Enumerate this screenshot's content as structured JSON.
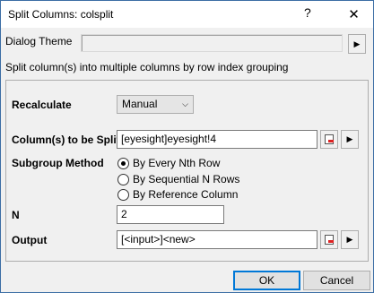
{
  "window": {
    "title": "Split Columns: colsplit",
    "help": "?",
    "close": "✕"
  },
  "theme": {
    "label": "Dialog Theme",
    "arrow": "▶"
  },
  "description": "Split column(s) into multiple columns by row index grouping",
  "recalculate": {
    "label": "Recalculate",
    "value": "Manual",
    "chevron": "⌵"
  },
  "columns": {
    "label": "Column(s) to be Split",
    "value": "[eyesight]eyesight!4",
    "arrow": "▶"
  },
  "subgroup": {
    "label": "Subgroup Method",
    "options": [
      {
        "label": "By Every Nth Row",
        "selected": true
      },
      {
        "label": "By Sequential N Rows",
        "selected": false
      },
      {
        "label": "By Reference Column",
        "selected": false
      }
    ]
  },
  "n": {
    "label": "N",
    "value": "2"
  },
  "output": {
    "label": "Output",
    "value": "[<input>]<new>",
    "arrow": "▶"
  },
  "buttons": {
    "ok": "OK",
    "cancel": "Cancel"
  }
}
